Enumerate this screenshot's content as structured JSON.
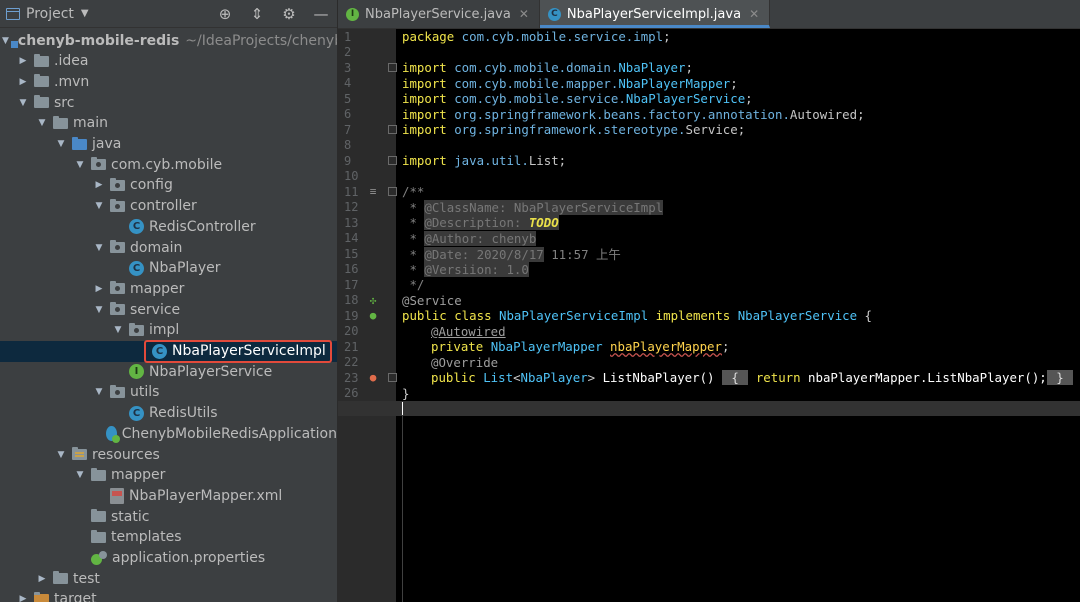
{
  "project_panel": {
    "title": "Project",
    "tools": [
      "target-icon",
      "collapse-icon",
      "gear-icon",
      "minimize-icon"
    ],
    "root": {
      "name": "chenyb-mobile-redis",
      "path": "~/IdeaProjects/chenyb-m"
    },
    "items": [
      {
        "label": ".idea"
      },
      {
        "label": ".mvn"
      },
      {
        "label": "src"
      },
      {
        "label": "main"
      },
      {
        "label": "java"
      },
      {
        "label": "com.cyb.mobile"
      },
      {
        "label": "config"
      },
      {
        "label": "controller"
      },
      {
        "label": "RedisController"
      },
      {
        "label": "domain"
      },
      {
        "label": "NbaPlayer"
      },
      {
        "label": "mapper"
      },
      {
        "label": "service"
      },
      {
        "label": "impl"
      },
      {
        "label": "NbaPlayerServiceImpl"
      },
      {
        "label": "NbaPlayerService"
      },
      {
        "label": "utils"
      },
      {
        "label": "RedisUtils"
      },
      {
        "label": "ChenybMobileRedisApplication"
      },
      {
        "label": "resources"
      },
      {
        "label": "mapper"
      },
      {
        "label": "NbaPlayerMapper.xml"
      },
      {
        "label": "static"
      },
      {
        "label": "templates"
      },
      {
        "label": "application.properties"
      },
      {
        "label": "test"
      },
      {
        "label": "target"
      }
    ]
  },
  "tabs": [
    {
      "label": "NbaPlayerService.java",
      "icon": "interface-icon",
      "active": false
    },
    {
      "label": "NbaPlayerServiceImpl.java",
      "icon": "class-icon",
      "active": true
    }
  ],
  "editor": {
    "line_numbers": [
      "1",
      "2",
      "3",
      "4",
      "5",
      "6",
      "7",
      "8",
      "9",
      "10",
      "11",
      "12",
      "13",
      "14",
      "15",
      "16",
      "17",
      "18",
      "19",
      "20",
      "21",
      "22",
      "23",
      "26"
    ],
    "code": {
      "l1_kw": "package",
      "l1_pkg": " com.cyb.mobile.service.impl",
      "l1_end": ";",
      "l3_kw": "import",
      "l3_pkg": " com.cyb.mobile.domain.",
      "l3_cls": "NbaPlayer",
      "l3_end": ";",
      "l4_kw": "import",
      "l4_pkg": " com.cyb.mobile.mapper.",
      "l4_cls": "NbaPlayerMapper",
      "l4_end": ";",
      "l5_kw": "import",
      "l5_pkg": " com.cyb.mobile.service.",
      "l5_cls": "NbaPlayerService",
      "l5_end": ";",
      "l6_kw": "import",
      "l6_pkg": " org.springframework.beans.factory.annotation.",
      "l6_cls": "Autowired",
      "l6_end": ";",
      "l7_kw": "import",
      "l7_pkg": " org.springframework.stereotype.",
      "l7_cls": "Service",
      "l7_end": ";",
      "l9_kw": "import",
      "l9_pkg": " java.util.",
      "l9_cls": "List",
      "l9_end": ";",
      "l11": "/**",
      "l12_star": " * ",
      "l12_tag": "@ClassName",
      "l12_val": ": NbaPlayerServiceImpl",
      "l13_star": " * ",
      "l13_tag": "@Description",
      "l13_colon": ": ",
      "l13_todo": "TODO",
      "l14_star": " * ",
      "l14_tag": "@Author",
      "l14_val": ": chenyb",
      "l15_star": " * ",
      "l15_tag": "@Date",
      "l15_val": ": 2020/8/17",
      "l15_rest": " 11:57 上午",
      "l16_star": " * ",
      "l16_tag": "@Versiion",
      "l16_val": ": 1.0",
      "l17": " */",
      "l18": "@Service",
      "l19_kw1": "public",
      "l19_kw2": " class ",
      "l19_cls": "NbaPlayerServiceImpl",
      "l19_kw3": " implements ",
      "l19_iface": "NbaPlayerService",
      "l19_end": " {",
      "l20_ann": "@Autowired",
      "l21_kw": "private ",
      "l21_cls": "NbaPlayerMapper ",
      "l21_fld": "nbaPlayerMapper",
      "l21_end": ";",
      "l22": "@Override",
      "l23_kw": "public ",
      "l23_cls": "List",
      "l23_lt": "<",
      "l23_cls2": "NbaPlayer",
      "l23_gt": "> ",
      "l23_meth": "ListNbaPlayer()",
      "l23_sp": " ",
      "l23_ob": " { ",
      "l23_ret": " return ",
      "l23_call": "nbaPlayerMapper.ListNbaPlayer();",
      "l23_cb": " } ",
      "l26": "}"
    }
  }
}
